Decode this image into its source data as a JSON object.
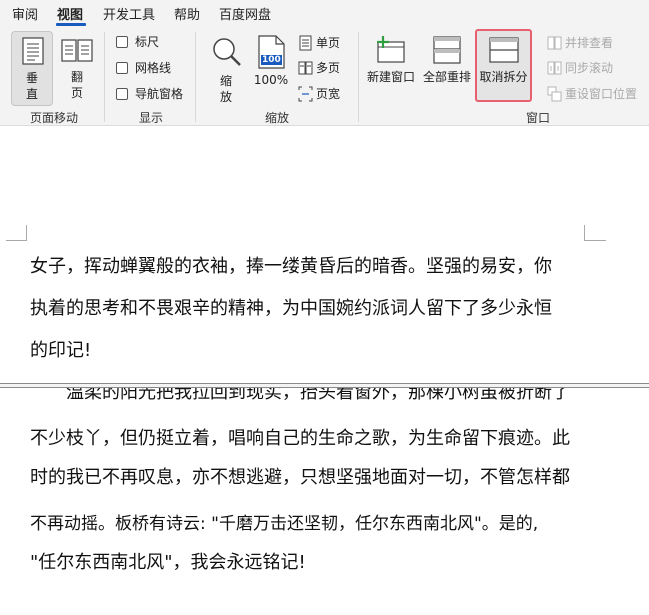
{
  "tabs": [
    {
      "label": "审阅",
      "active": false
    },
    {
      "label": "视图",
      "active": true
    },
    {
      "label": "开发工具",
      "active": false
    },
    {
      "label": "帮助",
      "active": false
    },
    {
      "label": "百度网盘",
      "active": false
    }
  ],
  "ribbon": {
    "page_movement": {
      "group_label": "页面移动",
      "vertical_line1": "垂",
      "vertical_line2": "直",
      "flip_line1": "翻",
      "flip_line2": "页"
    },
    "show": {
      "group_label": "显示",
      "ruler": "标尺",
      "gridlines": "网格线",
      "nav_pane": "导航窗格"
    },
    "zoom": {
      "group_label": "缩放",
      "zoom_line1": "缩",
      "zoom_line2": "放",
      "hundred_label": "100%",
      "hundred_icon_text": "100",
      "single_page": "单页",
      "multi_page": "多页",
      "page_width": "页宽"
    },
    "window": {
      "group_label": "窗口",
      "new_window": "新建窗口",
      "arrange_all": "全部重排",
      "remove_split": "取消拆分",
      "side_by_side": "并排查看",
      "sync_scroll": "同步滚动",
      "reset_position": "重设窗口位置"
    }
  },
  "colors": {
    "accent": "#185abd",
    "highlight_border": "#e8606f",
    "new_window_plus": "#2e9e3e",
    "disabled_text": "#a9a9a9"
  },
  "document": {
    "top_pane_lines": [
      "女子，挥动蝉翼般的衣袖，捧一缕黄昏后的暗香。坚强的易安，你",
      "执着的思考和不畏艰辛的精神，为中国婉约派词人留下了多少永恒",
      "的印记!"
    ],
    "bottom_pane_lines": [
      "　　温柔的阳光把我拉回到现实，抬头看窗外，那棵小树虽被折断了",
      "不少枝丫，但仍挺立着，唱响自己的生命之歌，为生命留下痕迹。此",
      "时的我已不再叹息，亦不想逃避，只想坚强地面对一切，不管怎样都",
      "不再动摇。板桥有诗云: \"千磨万击还坚韧，任尔东西南北风\"。是的,",
      "\"任尔东西南北风\"，我会永远铭记!"
    ]
  }
}
